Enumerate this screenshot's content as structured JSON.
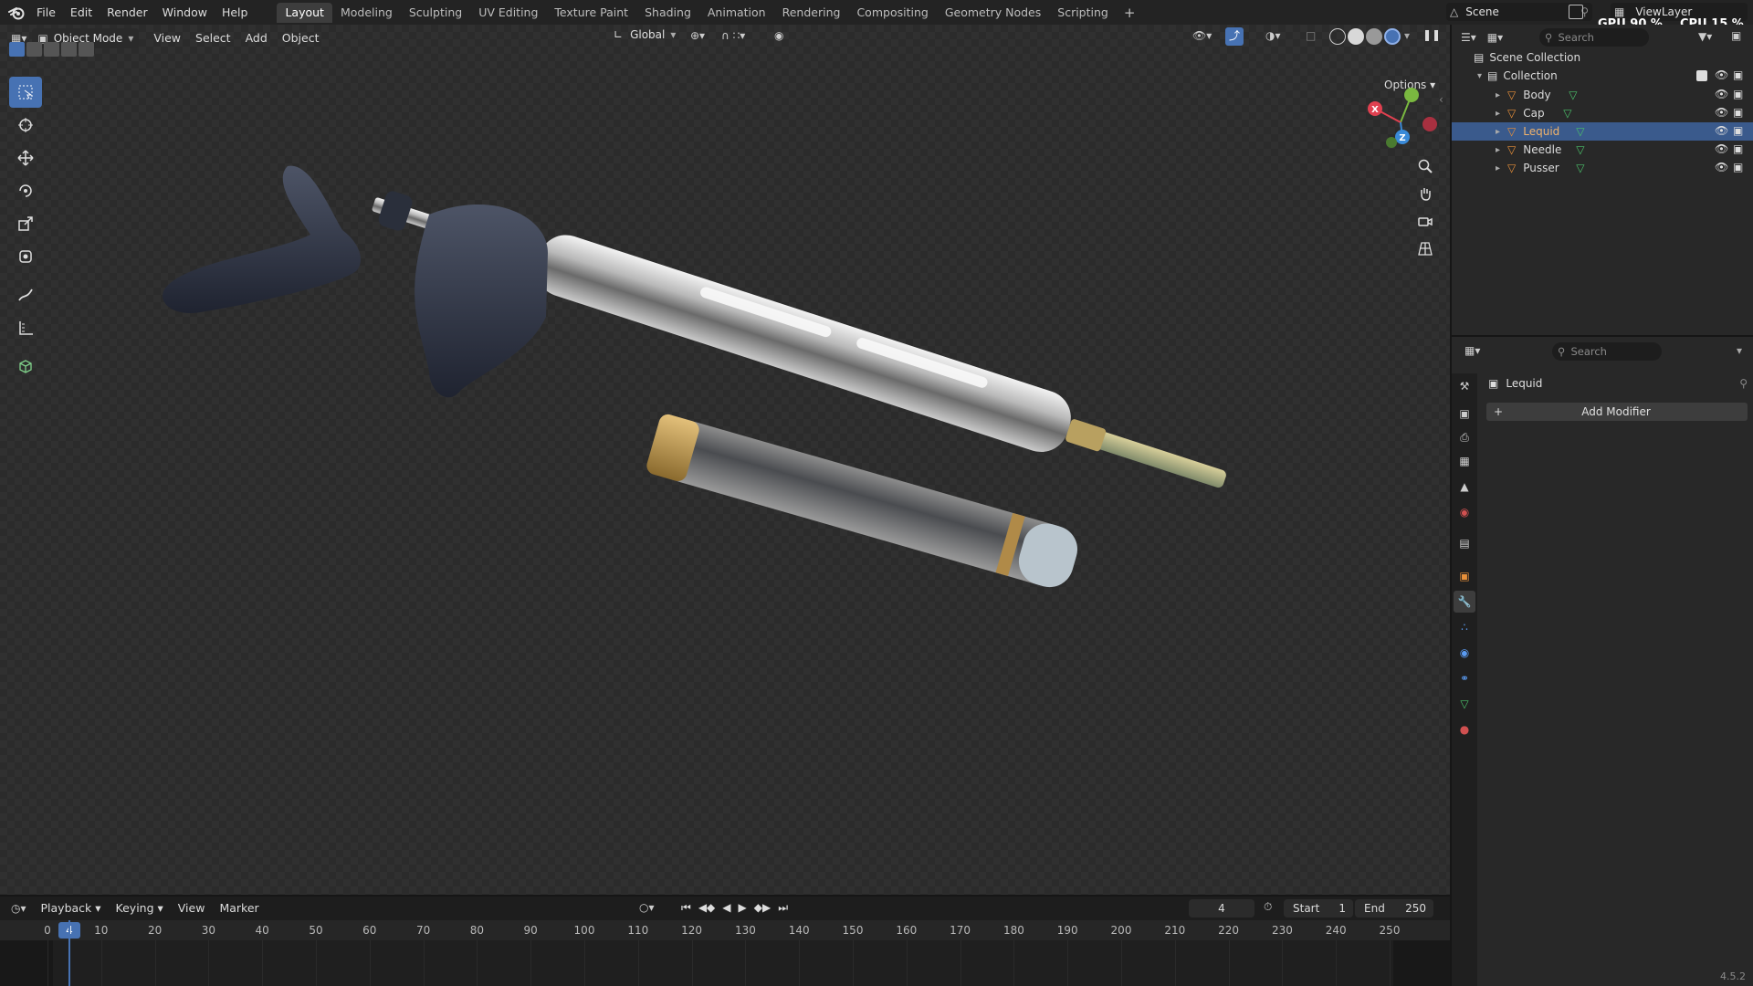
{
  "topbar": {
    "menus": [
      "File",
      "Edit",
      "Render",
      "Window",
      "Help"
    ],
    "workspaces": [
      "Layout",
      "Modeling",
      "Sculpting",
      "UV Editing",
      "Texture Paint",
      "Shading",
      "Animation",
      "Rendering",
      "Compositing",
      "Geometry Nodes",
      "Scripting"
    ],
    "active_workspace": "Layout",
    "add_workspace": "+",
    "scene": "Scene",
    "view_layer": "ViewLayer",
    "gpu": "GPU 90 %",
    "cpu": "CPU 15 %"
  },
  "viewport_header": {
    "mode": "Object Mode",
    "menus": [
      "View",
      "Select",
      "Add",
      "Object"
    ],
    "transform_orientation": "Global",
    "options": "Options"
  },
  "outliner": {
    "search_placeholder": "Search",
    "scene_collection": "Scene Collection",
    "collection": "Collection",
    "objects": [
      "Body",
      "Cap",
      "Lequid",
      "Needle",
      "Pusser"
    ],
    "selected": "Lequid"
  },
  "properties": {
    "search_placeholder": "Search",
    "object_name": "Lequid",
    "add_modifier": "Add Modifier"
  },
  "timeline": {
    "menus": [
      "Playback",
      "Keying",
      "View",
      "Marker"
    ],
    "current_frame": "4",
    "start_label": "Start",
    "start_value": "1",
    "end_label": "End",
    "end_value": "250",
    "ticks": [
      "0",
      "10",
      "20",
      "30",
      "40",
      "50",
      "60",
      "70",
      "80",
      "90",
      "100",
      "110",
      "120",
      "130",
      "140",
      "150",
      "160",
      "170",
      "180",
      "190",
      "200",
      "210",
      "220",
      "230",
      "240",
      "250"
    ]
  },
  "gizmo": {
    "x": "X",
    "y": "Y",
    "z": "Z"
  },
  "version": "4.5.2",
  "colors": {
    "accent": "#4772b3",
    "selection": "#3a5a8c",
    "object_orange": "#e8903a",
    "mesh_green": "#4bc06a",
    "axis_x": "#e04050",
    "axis_y": "#7ab840",
    "axis_z": "#3a8ad8"
  }
}
